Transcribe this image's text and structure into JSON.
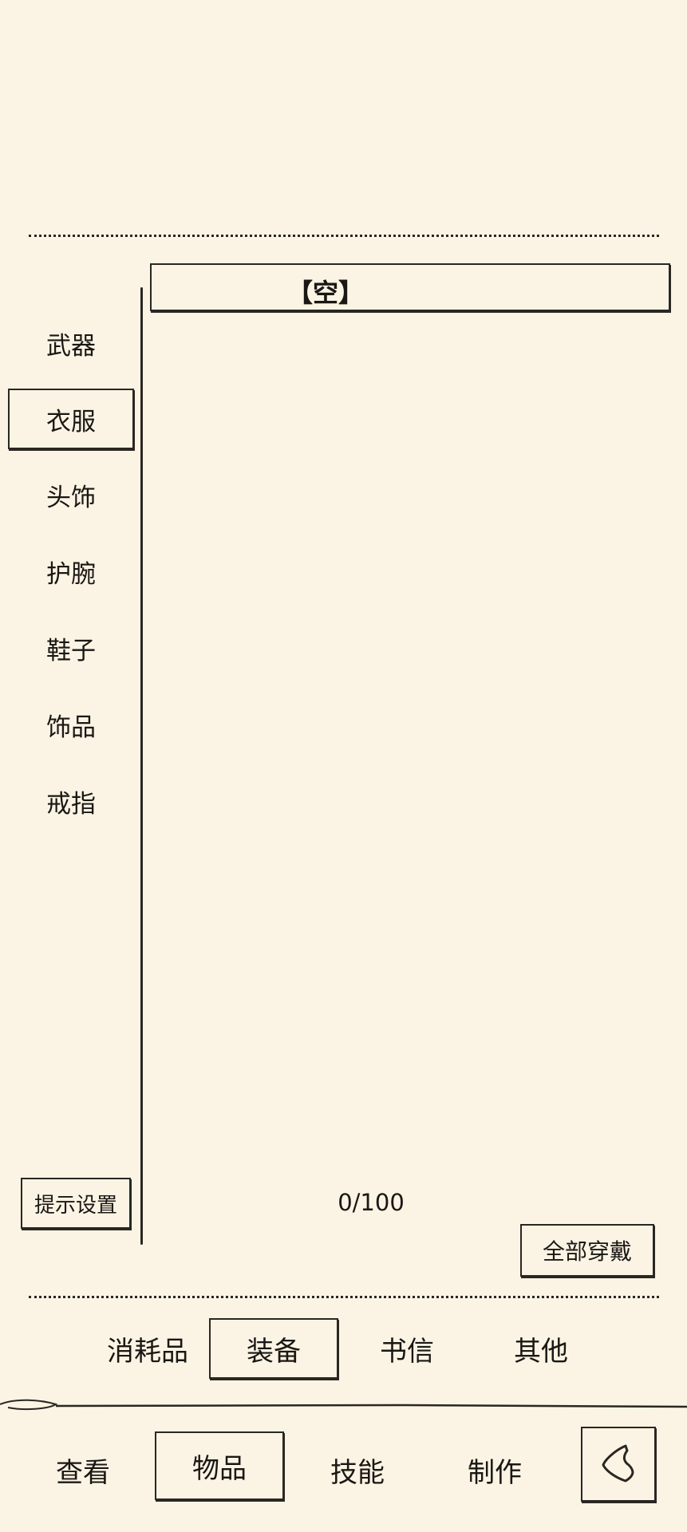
{
  "slot": {
    "label": "【空】"
  },
  "categories": [
    {
      "label": "武器",
      "active": false
    },
    {
      "label": "衣服",
      "active": true
    },
    {
      "label": "头饰",
      "active": false
    },
    {
      "label": "护腕",
      "active": false
    },
    {
      "label": "鞋子",
      "active": false
    },
    {
      "label": "饰品",
      "active": false
    },
    {
      "label": "戒指",
      "active": false
    }
  ],
  "hint_settings_label": "提示设置",
  "capacity": "0/100",
  "equip_all_label": "全部穿戴",
  "item_tabs": [
    {
      "label": "消耗品",
      "active": false
    },
    {
      "label": "装备",
      "active": true
    },
    {
      "label": "书信",
      "active": false
    },
    {
      "label": "其他",
      "active": false
    }
  ],
  "bottom_nav": [
    {
      "label": "查看",
      "active": false
    },
    {
      "label": "物品",
      "active": true
    },
    {
      "label": "技能",
      "active": false
    },
    {
      "label": "制作",
      "active": false
    }
  ],
  "back_icon": "back-chevron-icon"
}
